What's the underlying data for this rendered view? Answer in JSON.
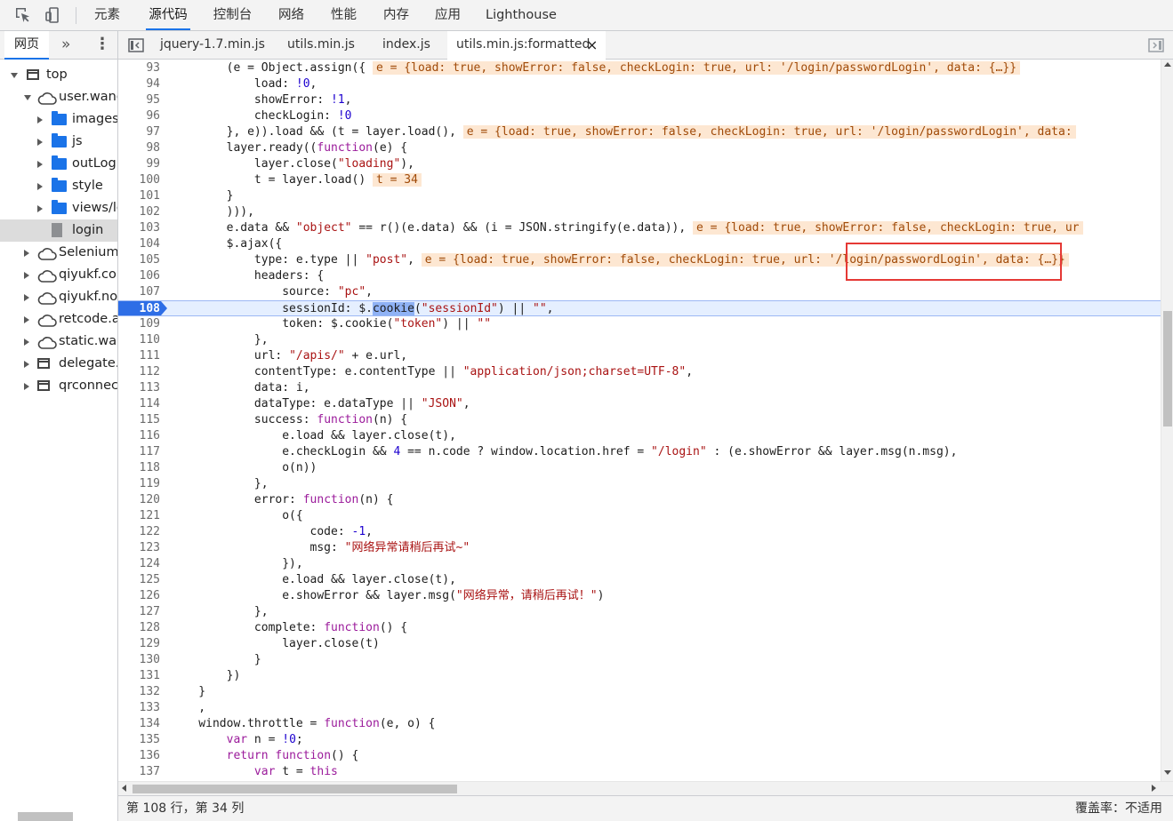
{
  "toolbar": {
    "tabs": [
      "元素",
      "源代码",
      "控制台",
      "网络",
      "性能",
      "内存",
      "应用",
      "Lighthouse"
    ],
    "active_tab": "源代码"
  },
  "navigator": {
    "tabs": [
      "网页"
    ],
    "more": "»",
    "menu": "⋮",
    "tree": [
      {
        "label": "top",
        "type": "frame",
        "expanded": true
      },
      {
        "label": "user.wang",
        "type": "cloud",
        "expanded": true
      },
      {
        "label": "images",
        "type": "folder",
        "expanded": false
      },
      {
        "label": "js",
        "type": "folder",
        "expanded": false
      },
      {
        "label": "outLogi",
        "type": "folder",
        "expanded": false
      },
      {
        "label": "style",
        "type": "folder",
        "expanded": false
      },
      {
        "label": "views/lo",
        "type": "folder",
        "expanded": false
      },
      {
        "label": "login",
        "type": "file",
        "selected": true
      },
      {
        "label": "Selenium",
        "type": "cloud",
        "expanded": false
      },
      {
        "label": "qiyukf.com",
        "type": "cloud",
        "expanded": false
      },
      {
        "label": "qiyukf.nos",
        "type": "cloud",
        "expanded": false
      },
      {
        "label": "retcode.al",
        "type": "cloud",
        "expanded": false
      },
      {
        "label": "static.wan",
        "type": "cloud",
        "expanded": false
      },
      {
        "label": "delegate.h",
        "type": "frame",
        "expanded": false
      },
      {
        "label": "qrconnect",
        "type": "frame",
        "expanded": false
      }
    ]
  },
  "editor": {
    "tabs": [
      "jquery-1.7.min.js",
      "utils.min.js",
      "index.js",
      "utils.min.js:formatted"
    ],
    "active_tab": "utils.min.js:formatted",
    "close": "×",
    "execution_line": 108,
    "lines": [
      {
        "n": "93",
        "t": [
          [
            "",
            "        (e = Object.assign({ "
          ],
          [
            "v",
            "e = {load: true, showError: false, checkLogin: true, url: '/login/passwordLogin', data: {…}}"
          ]
        ]
      },
      {
        "n": "94",
        "t": [
          [
            "",
            "            load: "
          ],
          [
            "n",
            "!0"
          ],
          [
            "",
            ","
          ]
        ]
      },
      {
        "n": "95",
        "t": [
          [
            "",
            "            showError: "
          ],
          [
            "n",
            "!1"
          ],
          [
            "",
            ","
          ]
        ]
      },
      {
        "n": "96",
        "t": [
          [
            "",
            "            checkLogin: "
          ],
          [
            "n",
            "!0"
          ]
        ]
      },
      {
        "n": "97",
        "t": [
          [
            "",
            "        }, e)).load && (t = layer.load(), "
          ],
          [
            "v",
            "e = {load: true, showError: false, checkLogin: true, url: '/login/passwordLogin', data:"
          ]
        ]
      },
      {
        "n": "98",
        "t": [
          [
            "",
            "        layer.ready(("
          ],
          [
            "k",
            "function"
          ],
          [
            "",
            "(e) {"
          ]
        ]
      },
      {
        "n": "99",
        "t": [
          [
            "",
            "            layer.close("
          ],
          [
            "s",
            "\"loading\""
          ],
          [
            "",
            "),"
          ]
        ]
      },
      {
        "n": "100",
        "t": [
          [
            "",
            "            t = layer.load() "
          ],
          [
            "v",
            "t = 34"
          ]
        ]
      },
      {
        "n": "101",
        "t": [
          [
            "",
            "        }"
          ]
        ]
      },
      {
        "n": "102",
        "t": [
          [
            "",
            "        ))),"
          ]
        ]
      },
      {
        "n": "103",
        "t": [
          [
            "",
            "        e.data && "
          ],
          [
            "s",
            "\"object\""
          ],
          [
            "",
            " == r()(e.data) && (i = JSON.stringify(e.data)), "
          ],
          [
            "v",
            "e = {load: true, showError: false, checkLogin: true, ur"
          ]
        ]
      },
      {
        "n": "104",
        "t": [
          [
            "",
            "        $.ajax({"
          ]
        ]
      },
      {
        "n": "105",
        "t": [
          [
            "",
            "            type: e.type || "
          ],
          [
            "s",
            "\"post\""
          ],
          [
            "",
            ", "
          ],
          [
            "v",
            "e = {load: true, showError: false, checkLogin: true, url: '/login/passwordLogin', data: {…}}"
          ]
        ]
      },
      {
        "n": "106",
        "t": [
          [
            "",
            "            headers: {"
          ]
        ]
      },
      {
        "n": "107",
        "t": [
          [
            "",
            "                source: "
          ],
          [
            "s",
            "\"pc\""
          ],
          [
            "",
            ","
          ]
        ]
      },
      {
        "n": "108",
        "t": [
          [
            "",
            "                sessionId: $."
          ],
          [
            "h",
            "cookie"
          ],
          [
            "",
            "("
          ],
          [
            "s",
            "\"sessionId\""
          ],
          [
            "",
            ") || "
          ],
          [
            "s",
            "\"\""
          ],
          [
            "",
            ","
          ]
        ]
      },
      {
        "n": "109",
        "t": [
          [
            "",
            "                token: $.cookie("
          ],
          [
            "s",
            "\"token\""
          ],
          [
            "",
            ") || "
          ],
          [
            "s",
            "\"\""
          ]
        ]
      },
      {
        "n": "110",
        "t": [
          [
            "",
            "            },"
          ]
        ]
      },
      {
        "n": "111",
        "t": [
          [
            "",
            "            url: "
          ],
          [
            "s",
            "\"/apis/\""
          ],
          [
            "",
            " + e.url,"
          ]
        ]
      },
      {
        "n": "112",
        "t": [
          [
            "",
            "            contentType: e.contentType || "
          ],
          [
            "s",
            "\"application/json;charset=UTF-8\""
          ],
          [
            "",
            ","
          ]
        ]
      },
      {
        "n": "113",
        "t": [
          [
            "",
            "            data: i,"
          ]
        ]
      },
      {
        "n": "114",
        "t": [
          [
            "",
            "            dataType: e.dataType || "
          ],
          [
            "s",
            "\"JSON\""
          ],
          [
            "",
            ","
          ]
        ]
      },
      {
        "n": "115",
        "t": [
          [
            "",
            "            success: "
          ],
          [
            "k",
            "function"
          ],
          [
            "",
            "(n) {"
          ]
        ]
      },
      {
        "n": "116",
        "t": [
          [
            "",
            "                e.load && layer.close(t),"
          ]
        ]
      },
      {
        "n": "117",
        "t": [
          [
            "",
            "                e.checkLogin && "
          ],
          [
            "n",
            "4"
          ],
          [
            "",
            " == n.code ? window.location.href = "
          ],
          [
            "s",
            "\"/login\""
          ],
          [
            "",
            " : (e.showError && layer.msg(n.msg),"
          ]
        ]
      },
      {
        "n": "118",
        "t": [
          [
            "",
            "                o(n))"
          ]
        ]
      },
      {
        "n": "119",
        "t": [
          [
            "",
            "            },"
          ]
        ]
      },
      {
        "n": "120",
        "t": [
          [
            "",
            "            error: "
          ],
          [
            "k",
            "function"
          ],
          [
            "",
            "(n) {"
          ]
        ]
      },
      {
        "n": "121",
        "t": [
          [
            "",
            "                o({"
          ]
        ]
      },
      {
        "n": "122",
        "t": [
          [
            "",
            "                    code: "
          ],
          [
            "n",
            "-1"
          ],
          [
            "",
            ","
          ]
        ]
      },
      {
        "n": "123",
        "t": [
          [
            "",
            "                    msg: "
          ],
          [
            "s",
            "\"网络异常请稍后再试~\""
          ]
        ]
      },
      {
        "n": "124",
        "t": [
          [
            "",
            "                }),"
          ]
        ]
      },
      {
        "n": "125",
        "t": [
          [
            "",
            "                e.load && layer.close(t),"
          ]
        ]
      },
      {
        "n": "126",
        "t": [
          [
            "",
            "                e.showError && layer.msg("
          ],
          [
            "s",
            "\"网络异常，请稍后再试！\""
          ],
          [
            "",
            ")"
          ]
        ]
      },
      {
        "n": "127",
        "t": [
          [
            "",
            "            },"
          ]
        ]
      },
      {
        "n": "128",
        "t": [
          [
            "",
            "            complete: "
          ],
          [
            "k",
            "function"
          ],
          [
            "",
            "() {"
          ]
        ]
      },
      {
        "n": "129",
        "t": [
          [
            "",
            "                layer.close(t)"
          ]
        ]
      },
      {
        "n": "130",
        "t": [
          [
            "",
            "            }"
          ]
        ]
      },
      {
        "n": "131",
        "t": [
          [
            "",
            "        })"
          ]
        ]
      },
      {
        "n": "132",
        "t": [
          [
            "",
            "    }"
          ]
        ]
      },
      {
        "n": "133",
        "t": [
          [
            "",
            "    ,"
          ]
        ]
      },
      {
        "n": "134",
        "t": [
          [
            "",
            "    window.throttle = "
          ],
          [
            "k",
            "function"
          ],
          [
            "",
            "(e, o) {"
          ]
        ]
      },
      {
        "n": "135",
        "t": [
          [
            "",
            "        "
          ],
          [
            "k",
            "var"
          ],
          [
            "",
            " n = "
          ],
          [
            "n",
            "!0"
          ],
          [
            "",
            ";"
          ]
        ]
      },
      {
        "n": "136",
        "t": [
          [
            "",
            "        "
          ],
          [
            "k",
            "return"
          ],
          [
            "",
            " "
          ],
          [
            "k",
            "function"
          ],
          [
            "",
            "() {"
          ]
        ]
      },
      {
        "n": "137",
        "t": [
          [
            "",
            "            "
          ],
          [
            "k",
            "var"
          ],
          [
            "",
            " t = "
          ],
          [
            "k",
            "this"
          ]
        ]
      }
    ]
  },
  "status": {
    "position": "第 108 行，第 34 列",
    "coverage": "覆盖率：不适用"
  },
  "colors": {
    "accent": "#1a73e8",
    "string": "#a91313",
    "keyword": "#9b1b9b",
    "inline_value_bg": "#fde7d2",
    "annotation_box": "#e53935"
  }
}
